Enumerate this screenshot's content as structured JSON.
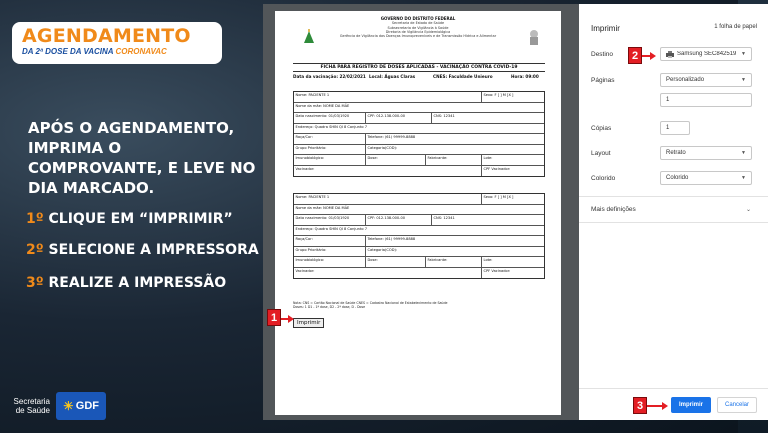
{
  "logo": {
    "title": "AGENDAMENTO",
    "subtitle_prefix": "DA 2ª DOSE DA VACINA ",
    "subtitle_brand": "CORONAVAC"
  },
  "headline": "APÓS O AGENDAMENTO, IMPRIMA O COMPROVANTE, E LEVE NO DIA MARCADO.",
  "steps": [
    {
      "num": "1º",
      "text": " CLIQUE EM “IMPRIMIR”"
    },
    {
      "num": "2º",
      "text": " SELECIONE A IMPRESSORA"
    },
    {
      "num": "3º",
      "text": " REALIZE A IMPRESSÃO"
    }
  ],
  "footer": {
    "secretaria": "Secretaria de Saúde",
    "gdf": "GDF"
  },
  "document": {
    "header_lines": [
      "GOVERNO DO DISTRITO FEDERAL",
      "Secretaria de Estado de Saúde",
      "Subsecretaria de Vigilância à Saúde",
      "Diretoria de Vigilância Epidemiológica",
      "Gerência de Vigilância das Doenças Imunopreveníveis e de Transmissão Hídrica e Alimentar"
    ],
    "title": "FICHA PARA REGISTRO DE DOSES APLICADAS - VACINAÇÃO CONTRA COVID-19",
    "vaccination_date": "Data da vacinação: 22/02/2021",
    "location": "Local: Águas Claras",
    "cnes": "CNES: Faculdade Unieuro",
    "time": "Hora: 09:00",
    "forms": [
      {
        "rows": [
          [
            "Nome: PACIENTE 1",
            "Sexo: F [ ] M [X ]"
          ],
          [
            "Nome da mãe: NOME DA MÃE"
          ],
          [
            "Data nascimento: 01/03/1920",
            "CPF: 012.138.000-00",
            "CNS: 12341"
          ],
          [
            "Endereço: Quadra SHIN QI 8 Conjunto 7"
          ],
          [
            "Raça/Cor:",
            "Telefone: (61) 99999-8888"
          ],
          [
            "Grupo Prioritário:",
            "Categoria(COD):"
          ],
          [
            "Imunobiológico:",
            "Dose:",
            "Fabricante:",
            "Lote:"
          ],
          [
            "Vacinador:",
            "CPF Vacinador:"
          ]
        ]
      },
      {
        "rows": [
          [
            "Nome: PACIENTE 1",
            "Sexo: F [ ] M [X ]"
          ],
          [
            "Nome da mãe: NOME DA MÃE"
          ],
          [
            "Data nascimento: 01/03/1920",
            "CPF: 012.138.000-00",
            "CNS: 12341"
          ],
          [
            "Endereço: Quadra SHIN QI 8 Conjunto 7"
          ],
          [
            "Raça/Cor:",
            "Telefone: (61) 99999-8888"
          ],
          [
            "Grupo Prioritário:",
            "Categoria(COD):"
          ],
          [
            "Imunobiológico:",
            "Dose:",
            "Fabricante:",
            "Lote:"
          ],
          [
            "Vacinador:",
            "CPF Vacinador:"
          ]
        ]
      }
    ],
    "note_line1": "Nota: CNS = Cartão Nacional de Saúde  CNES = Cadastro Nacional de Estabelecimento de Saúde",
    "note_line2": "Doses: 1 D1 - 1ª dose, D2 - 2ª dose, D - Dose",
    "print_button": "Imprimir"
  },
  "print_panel": {
    "title": "Imprimir",
    "sheet_count": "1 folha de papel",
    "destination_label": "Destino",
    "destination_value": "Samsung SEC842519",
    "pages_label": "Páginas",
    "pages_value": "Personalizado",
    "pages_range": "1",
    "copies_label": "Cópias",
    "copies_value": "1",
    "layout_label": "Layout",
    "layout_value": "Retrato",
    "color_label": "Colorido",
    "color_value": "Colorido",
    "more_settings": "Mais definições",
    "print_button": "Imprimir",
    "cancel_button": "Cancelar"
  },
  "markers": [
    "1",
    "2",
    "3"
  ],
  "colors": {
    "accent_orange": "#f08a1a",
    "marker_red": "#e31e24",
    "print_blue": "#1a73e8",
    "brand_blue": "#1a4fa0"
  }
}
